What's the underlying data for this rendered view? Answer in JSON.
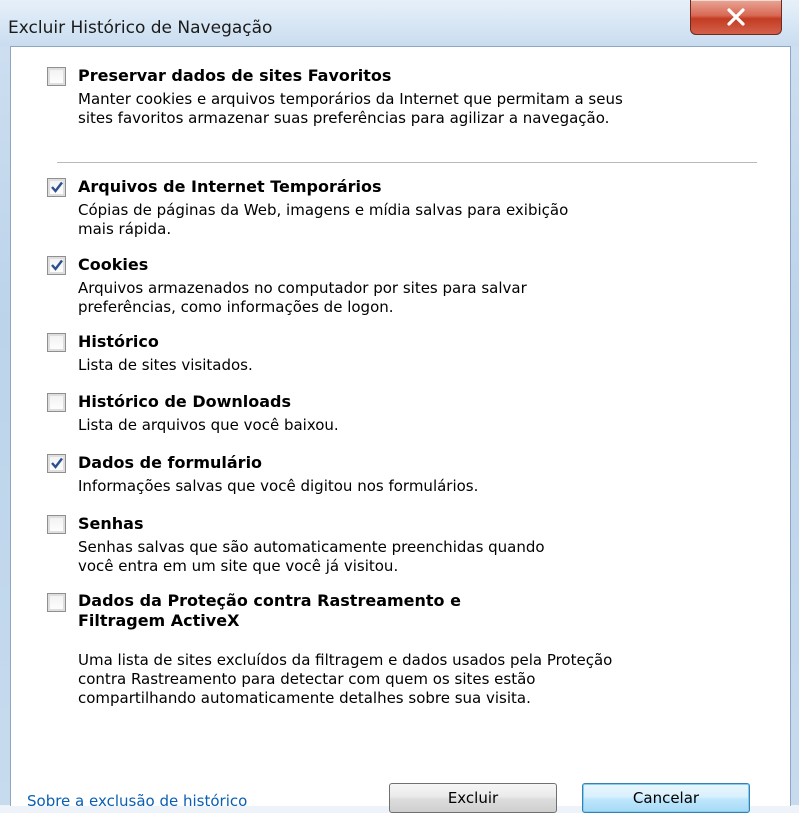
{
  "window": {
    "title": "Excluir Histórico de Navegação"
  },
  "options": [
    {
      "label": "Preservar dados de sites Favoritos",
      "checked": false,
      "desc": [
        "Manter cookies e arquivos temporários da Internet que permitam a seus",
        "sites favoritos armazenar suas preferências para agilizar a navegação."
      ]
    },
    {
      "label": "Arquivos de Internet Temporários",
      "checked": true,
      "desc": [
        "Cópias de páginas da Web, imagens e mídia salvas para exibição",
        "mais rápida."
      ]
    },
    {
      "label": "Cookies",
      "checked": true,
      "desc": [
        "Arquivos armazenados no computador por sites para salvar",
        "preferências, como informações de logon."
      ]
    },
    {
      "label": "Histórico",
      "checked": false,
      "desc": [
        "Lista de sites visitados."
      ]
    },
    {
      "label": "Histórico de Downloads",
      "checked": false,
      "desc": [
        "Lista de arquivos que você baixou."
      ]
    },
    {
      "label": "Dados de formulário",
      "checked": true,
      "desc": [
        "Informações salvas que você digitou nos formulários."
      ]
    },
    {
      "label": "Senhas",
      "checked": false,
      "desc": [
        "Senhas salvas que são automaticamente preenchidas quando",
        "você entra em um site que você já visitou."
      ]
    },
    {
      "label": [
        "Dados da Proteção contra Rastreamento e",
        "Filtragem ActiveX"
      ],
      "checked": false,
      "desc": [
        "Uma lista de sites excluídos da filtragem e dados usados pela Proteção",
        "contra Rastreamento para detectar com quem os sites estão",
        "compartilhando automaticamente detalhes sobre sua visita."
      ]
    }
  ],
  "footer": {
    "link": "Sobre a exclusão de histórico",
    "delete_button": "Excluir",
    "cancel_button": "Cancelar"
  },
  "icons": {
    "close": "close-icon",
    "check": "checkmark-icon"
  }
}
